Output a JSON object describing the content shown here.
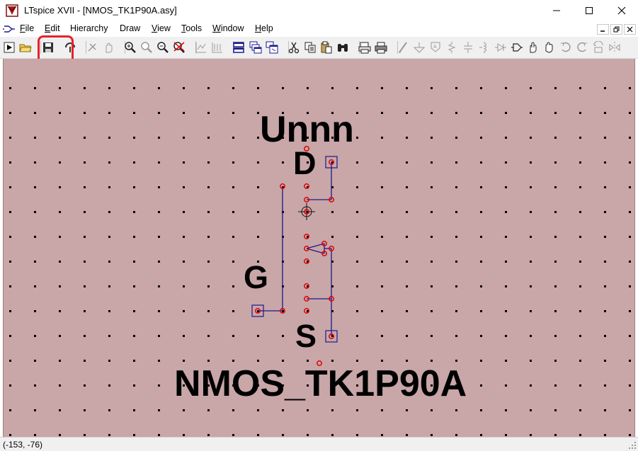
{
  "window": {
    "title": "LTspice XVII - [NMOS_TK1P90A.asy]",
    "icons": [
      "ltspice-logo-icon",
      "minimize-icon",
      "maximize-icon",
      "close-icon"
    ]
  },
  "menu": {
    "items": [
      {
        "label_ul": "F",
        "label_rest": "ile"
      },
      {
        "label_ul": "E",
        "label_rest": "dit"
      },
      {
        "label_ul": "",
        "label_rest": "Hierarchy"
      },
      {
        "label_ul": "",
        "label_rest": "Draw"
      },
      {
        "label_ul": "V",
        "label_rest": "iew"
      },
      {
        "label_ul": "T",
        "label_rest": "ools"
      },
      {
        "label_ul": "W",
        "label_rest": "indow"
      },
      {
        "label_ul": "H",
        "label_rest": "elp"
      }
    ]
  },
  "toolbar": {
    "icons": [
      "run-icon",
      "open-icon",
      "save-icon",
      "control-panel-icon",
      "halt-icon",
      "pan-icon",
      "zoom-in-icon",
      "zoom-pan-icon",
      "zoom-out-icon",
      "zoom-cancel-icon",
      "autorange-icon",
      "grid-icon",
      "tile-horizontal-icon",
      "cascade-icon",
      "tile-vertical-icon",
      "cut-icon",
      "copy-icon",
      "paste-icon",
      "find-icon",
      "print-setup-icon",
      "print-icon",
      "wire-icon",
      "ground-icon",
      "label-icon",
      "resistor-icon",
      "capacitor-icon",
      "inductor-icon",
      "diode-icon",
      "component-icon",
      "move-icon",
      "drag-icon",
      "undo-icon",
      "redo-icon",
      "rotate-icon",
      "mirror-icon"
    ],
    "highlighted": "save-icon"
  },
  "symbol": {
    "instance_name": "Unnn",
    "model_name": "NMOS_TK1P90A",
    "pins": {
      "drain": "D",
      "gate": "G",
      "source": "S"
    }
  },
  "colors": {
    "canvas": "#c9a6a8",
    "wire": "#1a1a8c",
    "pin": "#e00000",
    "grid_dot": "#000000",
    "highlight": "#e8202a"
  },
  "status": {
    "coords": "(-153, -76)"
  }
}
